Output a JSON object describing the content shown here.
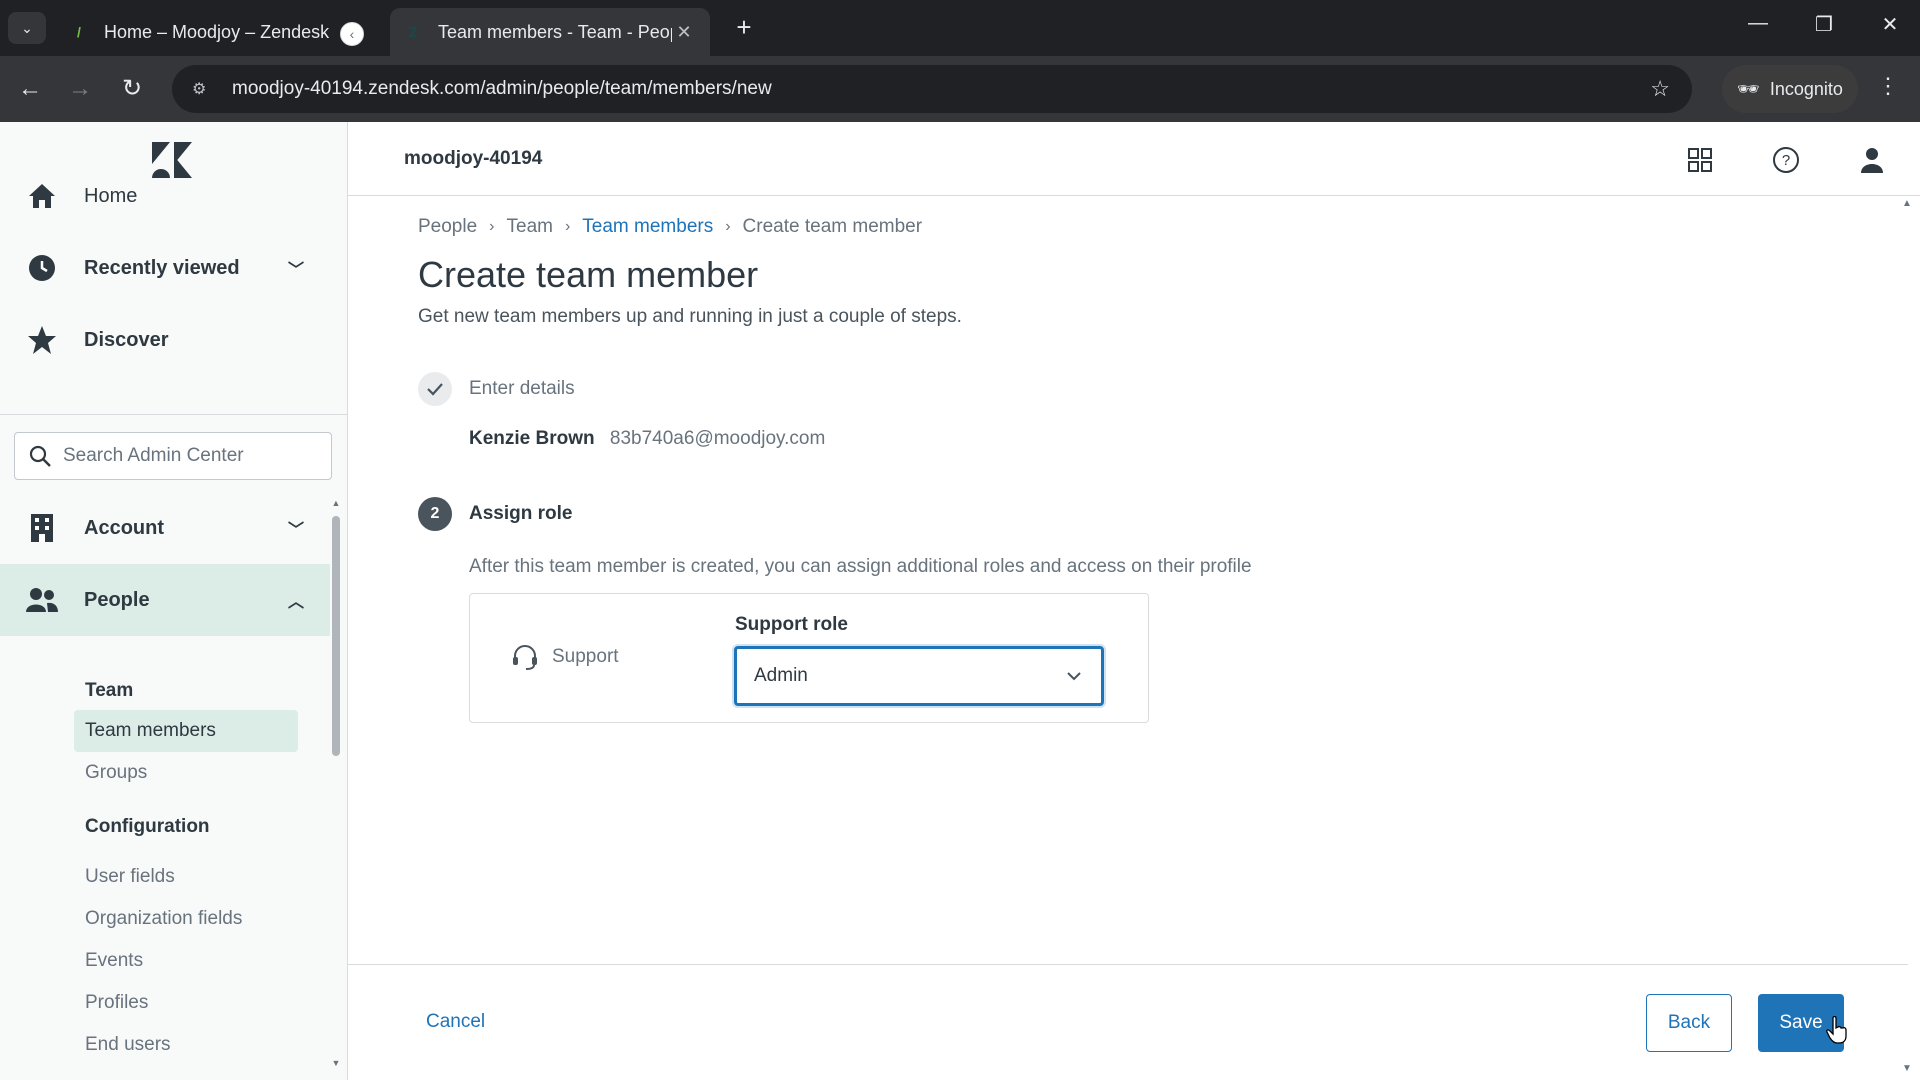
{
  "browser": {
    "tabs": [
      {
        "title": "Home – Moodjoy – Zendesk",
        "active": false
      },
      {
        "title": "Team members - Team - People",
        "active": true
      }
    ],
    "url": "moodjoy-40194.zendesk.com/admin/people/team/members/new",
    "incognito_label": "Incognito"
  },
  "sidebar": {
    "nav": [
      {
        "label": "Home",
        "icon": "home-icon"
      },
      {
        "label": "Recently viewed",
        "icon": "clock-icon"
      },
      {
        "label": "Discover",
        "icon": "star-icon"
      }
    ],
    "search_placeholder": "Search Admin Center",
    "sections": [
      {
        "label": "Account",
        "icon": "building-icon",
        "expanded": false
      },
      {
        "label": "People",
        "icon": "people-icon",
        "expanded": true
      }
    ],
    "team_heading": "Team",
    "team_items": [
      "Team members",
      "Groups"
    ],
    "config_heading": "Configuration",
    "config_items": [
      "User fields",
      "Organization fields",
      "Events",
      "Profiles",
      "End users"
    ]
  },
  "header": {
    "subdomain": "moodjoy-40194"
  },
  "main": {
    "breadcrumbs": [
      "People",
      "Team",
      "Team members",
      "Create team member"
    ],
    "title": "Create team member",
    "description": "Get new team members up and running in just a couple of steps.",
    "step1": {
      "label": "Enter details",
      "name": "Kenzie Brown",
      "email": "83b740a6@moodjoy.com"
    },
    "step2": {
      "number": "2",
      "label": "Assign role",
      "hint": "After this team member is created, you can assign additional roles and access on their profile"
    },
    "role": {
      "product": "Support",
      "field_label": "Support role",
      "selected": "Admin"
    },
    "actions": {
      "cancel": "Cancel",
      "back": "Back",
      "save": "Save"
    }
  },
  "colors": {
    "accent": "#1f73b7",
    "selected_bg": "#dcece7",
    "sidebar_bg": "#f8f9f9",
    "browser_dark": "#202124"
  }
}
